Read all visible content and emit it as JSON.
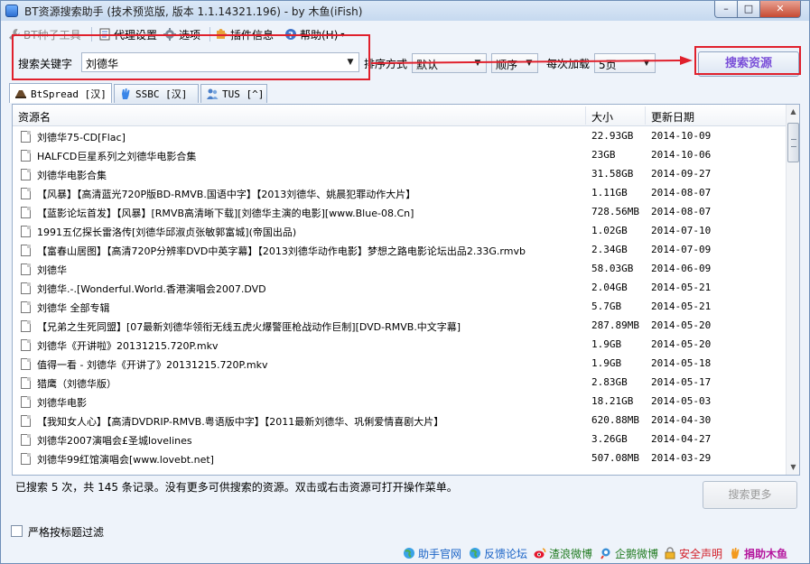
{
  "window": {
    "title": "BT资源搜索助手 (技术预览版, 版本 1.1.14321.196) - by 木鱼(iFish)",
    "controls": {
      "minimize": "–",
      "maximize": "□",
      "close": "✕"
    }
  },
  "menu": {
    "bt_tools": "BT种子工具",
    "proxy": "代理设置",
    "options": "选项",
    "plugins": "插件信息",
    "help": "帮助(H)"
  },
  "search": {
    "keyword_label": "搜索关键字",
    "keyword_value": "刘德华",
    "sort_label": "排序方式",
    "sort_value": "默认",
    "order_value": "顺序",
    "per_label": "每次加载",
    "per_value": "5页",
    "search_button": "搜索资源"
  },
  "tabs": [
    {
      "label": "BtSpread [汉]",
      "icon": "hat-icon"
    },
    {
      "label": "SSBC [汉]",
      "icon": "hand-icon"
    },
    {
      "label": "TUS [^]",
      "icon": "people-icon"
    }
  ],
  "table": {
    "columns": {
      "name": "资源名",
      "size": "大小",
      "date": "更新日期"
    },
    "rows": [
      {
        "name": "刘德华75-CD[Flac]",
        "size": "22.93GB",
        "date": "2014-10-09"
      },
      {
        "name": "HALFCD巨星系列之刘德华电影合集",
        "size": "23GB",
        "date": "2014-10-06"
      },
      {
        "name": "刘德华电影合集",
        "size": "31.58GB",
        "date": "2014-09-27"
      },
      {
        "name": "【风暴】【高清蓝光720P版BD-RMVB.国语中字】【2013刘德华、姚晨犯罪动作大片】",
        "size": "1.11GB",
        "date": "2014-08-07"
      },
      {
        "name": "【蓝影论坛首发】【风暴】[RMVB高清晰下载][刘德华主演的电影][www.Blue-08.Cn]",
        "size": "728.56MB",
        "date": "2014-08-07"
      },
      {
        "name": "1991五亿探长雷洛传[刘德华邱淑贞张敏郭富城](帝国出品)",
        "size": "1.02GB",
        "date": "2014-07-10"
      },
      {
        "name": "【富春山居图】【高清720P分辨率DVD中英字幕】【2013刘德华动作电影】梦想之路电影论坛出品2.33G.rmvb",
        "size": "2.34GB",
        "date": "2014-07-09"
      },
      {
        "name": "刘德华",
        "size": "58.03GB",
        "date": "2014-06-09"
      },
      {
        "name": "刘德华.-.[Wonderful.World.香港演唱会2007.DVD",
        "size": "2.04GB",
        "date": "2014-05-21"
      },
      {
        "name": "刘德华 全部专辑",
        "size": "5.7GB",
        "date": "2014-05-21"
      },
      {
        "name": "【兄弟之生死同盟】[07最新刘德华领衔无线五虎火爆警匪枪战动作巨制][DVD-RMVB.中文字幕]",
        "size": "287.89MB",
        "date": "2014-05-20"
      },
      {
        "name": "刘德华《开讲啦》20131215.720P.mkv",
        "size": "1.9GB",
        "date": "2014-05-20"
      },
      {
        "name": "值得一看 - 刘德华《开讲了》20131215.720P.mkv",
        "size": "1.9GB",
        "date": "2014-05-18"
      },
      {
        "name": "猎鹰（刘德华版）",
        "size": "2.83GB",
        "date": "2014-05-17"
      },
      {
        "name": "刘德华电影",
        "size": "18.21GB",
        "date": "2014-05-03"
      },
      {
        "name": "【我知女人心】【高清DVDRIP-RMVB.粤语版中字】【2011最新刘德华、巩俐爱情喜剧大片】",
        "size": "620.88MB",
        "date": "2014-04-30"
      },
      {
        "name": "刘德华2007演唱会£圣城lovelines",
        "size": "3.26GB",
        "date": "2014-04-27"
      },
      {
        "name": "刘德华99红馆演唱会[www.lovebt.net]",
        "size": "507.08MB",
        "date": "2014-03-29"
      }
    ]
  },
  "status": {
    "text": "已搜索 5 次，共 145 条记录。没有更多可供搜索的资源。双击或右击资源可打开操作菜单。",
    "more_button": "搜索更多",
    "strict_filter_label": "严格按标题过滤"
  },
  "links": {
    "home": "助手官网",
    "forum": "反馈论坛",
    "sina_weibo": "渣浪微博",
    "tencent_weibo": "企鹅微博",
    "declaration": "安全声明",
    "donate": "捐助木鱼"
  },
  "colors": {
    "annotation_red": "#e0202c",
    "search_button_text": "#7a4fd8",
    "donate_text": "#b5179e"
  }
}
